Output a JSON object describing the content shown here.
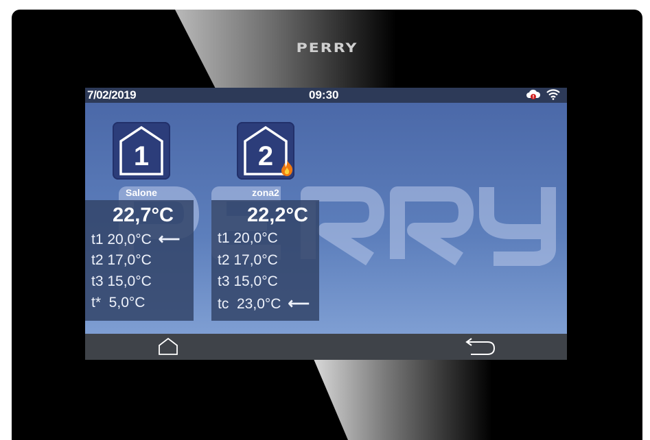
{
  "device": {
    "brand": "PERRY",
    "colors": {
      "bezel": "#000000",
      "screen_top": "#4966a6",
      "screen_bottom": "#88a7d9",
      "statusbar": "#2d3a58",
      "panel": "#324469",
      "navbar": "#3f4349",
      "flame": "#f07a10"
    }
  },
  "statusbar": {
    "date": "7/02/2019",
    "time": "09:30",
    "icons": [
      "cloud-alert-icon",
      "wifi-icon"
    ]
  },
  "zones": [
    {
      "number": "1",
      "name": "Salone",
      "heating": false,
      "temperature": "22,7°C",
      "setpoints": [
        {
          "text": "t1 20,0°C",
          "active": true
        },
        {
          "text": "t2 17,0°C",
          "active": false
        },
        {
          "text": "t3 15,0°C",
          "active": false
        },
        {
          "text": "t*  5,0°C",
          "active": false
        }
      ]
    },
    {
      "number": "2",
      "name": "zona2",
      "heating": true,
      "temperature": "22,2°C",
      "setpoints": [
        {
          "text": "t1 20,0°C",
          "active": false
        },
        {
          "text": "t2 17,0°C",
          "active": false
        },
        {
          "text": "t3 15,0°C",
          "active": false
        },
        {
          "text": "tc  23,0°C",
          "active": true
        }
      ]
    }
  ],
  "arrow_glyph": "⟵",
  "navbar": {
    "buttons": [
      "home-icon",
      "back-icon"
    ]
  }
}
